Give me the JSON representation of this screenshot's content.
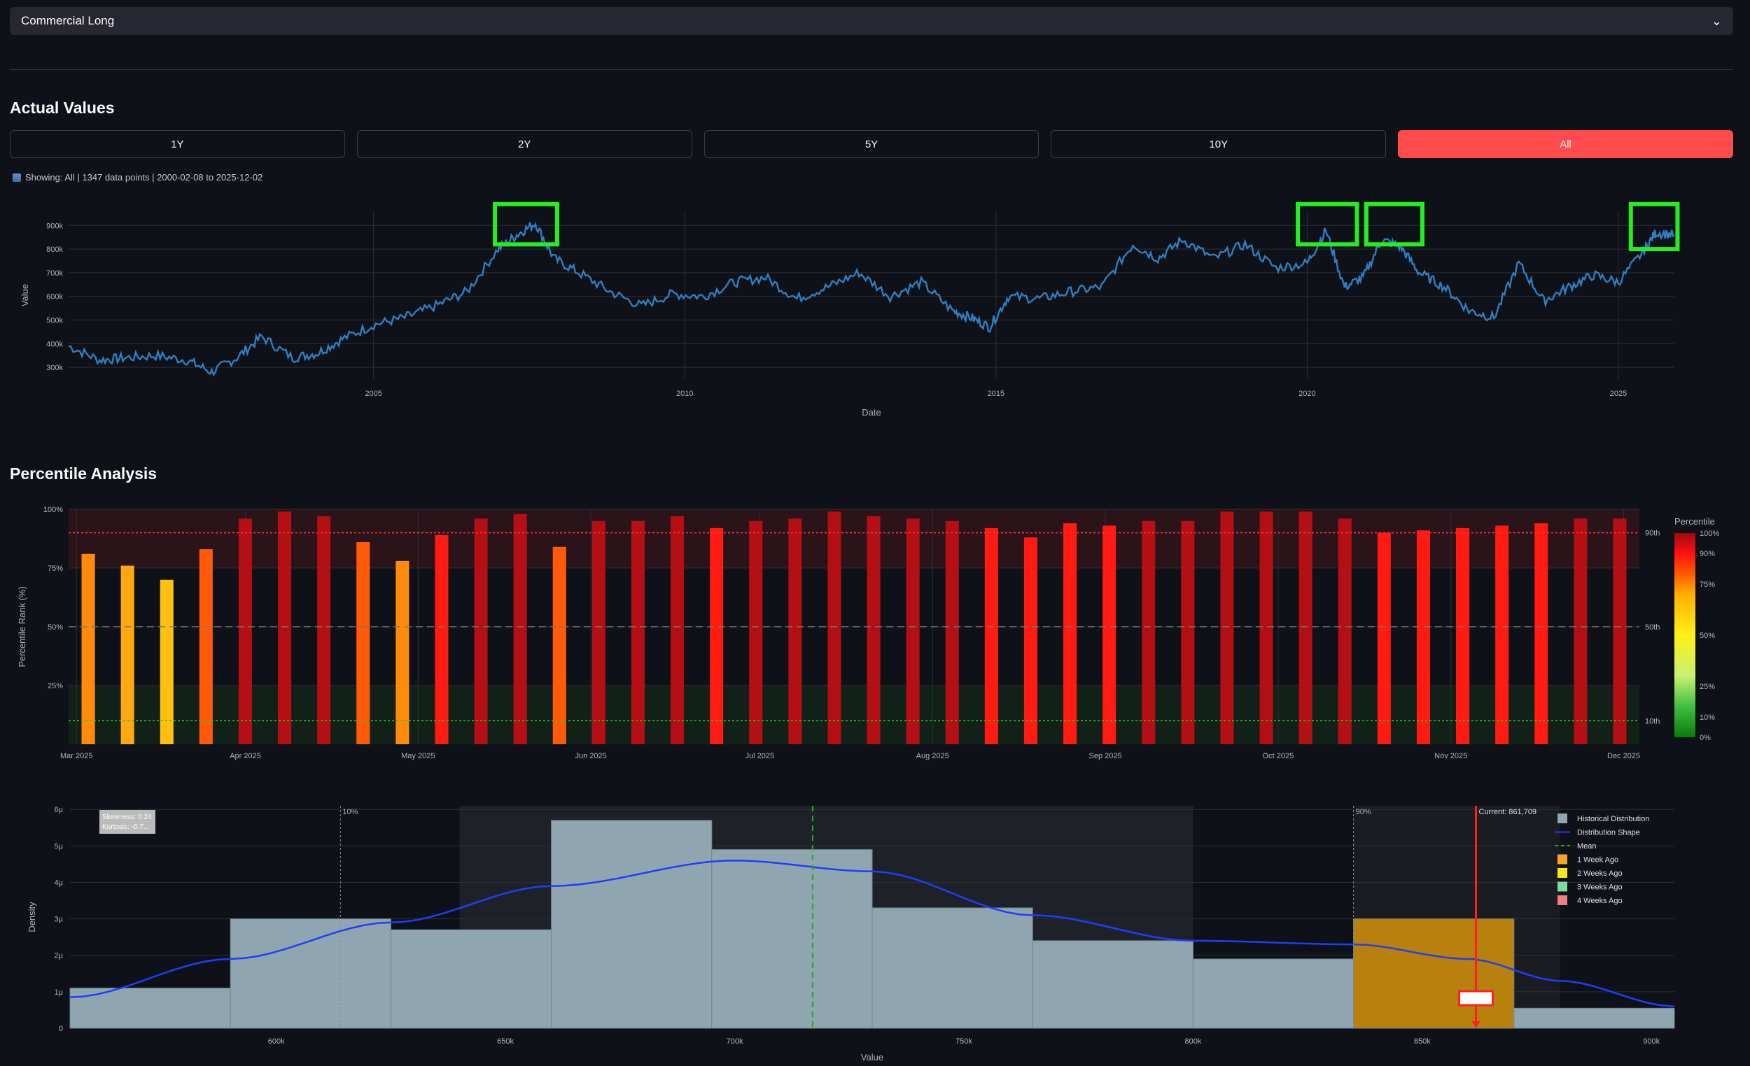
{
  "selector": {
    "value": "Commercial Long"
  },
  "sections": {
    "actual_title": "Actual Values",
    "percentile_title": "Percentile Analysis"
  },
  "ranges": [
    {
      "label": "1Y",
      "active": false
    },
    {
      "label": "2Y",
      "active": false
    },
    {
      "label": "5Y",
      "active": false
    },
    {
      "label": "10Y",
      "active": false
    },
    {
      "label": "All",
      "active": true
    }
  ],
  "caption": "Showing: All | 1347 data points | 2000-02-08 to 2025-12-02",
  "colors": {
    "accent": "#ff4b4b",
    "line": "#2f7fc1",
    "highlight": "#22ee22",
    "hist": "#8fa5b0",
    "current_bin": "#b8800d"
  },
  "chart_data": [
    {
      "type": "line",
      "xlabel": "Date",
      "ylabel": "Value",
      "xlim": [
        2000.1,
        2025.9
      ],
      "ylim": [
        250000,
        960000
      ],
      "x_ticks": [
        {
          "v": 2005,
          "label": "2005"
        },
        {
          "v": 2010,
          "label": "2010"
        },
        {
          "v": 2015,
          "label": "2015"
        },
        {
          "v": 2020,
          "label": "2020"
        },
        {
          "v": 2025,
          "label": "2025"
        }
      ],
      "y_ticks": [
        {
          "v": 300000,
          "label": "300k"
        },
        {
          "v": 400000,
          "label": "400k"
        },
        {
          "v": 500000,
          "label": "500k"
        },
        {
          "v": 600000,
          "label": "600k"
        },
        {
          "v": 700000,
          "label": "700k"
        },
        {
          "v": 800000,
          "label": "800k"
        },
        {
          "v": 900000,
          "label": "900k"
        }
      ],
      "x": [
        2000.1,
        2000.6,
        2001.0,
        2001.5,
        2002.0,
        2002.4,
        2002.8,
        2003.2,
        2003.7,
        2004.1,
        2004.5,
        2005.0,
        2005.5,
        2006.0,
        2006.5,
        2007.0,
        2007.3,
        2007.6,
        2007.9,
        2008.3,
        2008.8,
        2009.3,
        2009.8,
        2010.3,
        2010.8,
        2011.3,
        2011.8,
        2012.3,
        2012.8,
        2013.3,
        2013.8,
        2014.3,
        2014.6,
        2014.9,
        2015.2,
        2015.7,
        2016.2,
        2016.7,
        2017.2,
        2017.6,
        2018.0,
        2018.5,
        2019.0,
        2019.5,
        2020.0,
        2020.3,
        2020.6,
        2020.9,
        2021.2,
        2021.5,
        2021.8,
        2022.2,
        2022.6,
        2023.0,
        2023.4,
        2023.8,
        2024.2,
        2024.6,
        2025.0,
        2025.4,
        2025.6,
        2025.9
      ],
      "y": [
        390000,
        330000,
        340000,
        350000,
        330000,
        280000,
        340000,
        430000,
        340000,
        360000,
        420000,
        480000,
        510000,
        560000,
        620000,
        800000,
        860000,
        910000,
        760000,
        700000,
        620000,
        560000,
        610000,
        600000,
        660000,
        680000,
        590000,
        640000,
        700000,
        600000,
        660000,
        540000,
        510000,
        470000,
        600000,
        590000,
        620000,
        640000,
        820000,
        760000,
        840000,
        760000,
        820000,
        720000,
        740000,
        880000,
        640000,
        680000,
        840000,
        810000,
        700000,
        640000,
        540000,
        510000,
        740000,
        580000,
        640000,
        690000,
        660000,
        790000,
        870000,
        860000
      ],
      "highlights": [
        {
          "x0": 2006.95,
          "x1": 2007.95,
          "y0": 820000,
          "y1": 1000000
        },
        {
          "x0": 2019.85,
          "x1": 2020.8,
          "y0": 820000,
          "y1": 1000000
        },
        {
          "x0": 2020.95,
          "x1": 2021.85,
          "y0": 820000,
          "y1": 1000000
        },
        {
          "x0": 2025.2,
          "x1": 2025.95,
          "y0": 800000,
          "y1": 1000000
        }
      ]
    },
    {
      "type": "bar",
      "ylabel": "Percentile Rank (%)",
      "ylim": [
        0,
        100
      ],
      "y_ticks": [
        {
          "v": 25,
          "label": "25%"
        },
        {
          "v": 50,
          "label": "50%"
        },
        {
          "v": 75,
          "label": "75%"
        },
        {
          "v": 100,
          "label": "100%"
        }
      ],
      "x_ticks": [
        {
          "i": 0,
          "label": "Mar 2025"
        },
        {
          "i": 4.3,
          "label": "Apr 2025"
        },
        {
          "i": 8.7,
          "label": "May 2025"
        },
        {
          "i": 13.1,
          "label": "Jun 2025"
        },
        {
          "i": 17.4,
          "label": "Jul 2025"
        },
        {
          "i": 21.8,
          "label": "Aug 2025"
        },
        {
          "i": 26.2,
          "label": "Sep 2025"
        },
        {
          "i": 30.6,
          "label": "Oct 2025"
        },
        {
          "i": 35,
          "label": "Nov 2025"
        },
        {
          "i": 39.4,
          "label": "Dec 2025"
        }
      ],
      "values": [
        81,
        76,
        70,
        83,
        96,
        99,
        97,
        86,
        78,
        89,
        96,
        98,
        84,
        95,
        95,
        97,
        92,
        95,
        96,
        99,
        97,
        96,
        95,
        92,
        88,
        94,
        93,
        95,
        95,
        99,
        99,
        99,
        96,
        90,
        91,
        92,
        93,
        94,
        96,
        96
      ],
      "reference_lines": [
        {
          "v": 90,
          "label": "90th",
          "color": "#ff3030"
        },
        {
          "v": 50,
          "label": "50th",
          "color": "#777777"
        },
        {
          "v": 10,
          "label": "10th",
          "color": "#22cc22"
        }
      ],
      "colorbar": {
        "title": "Percentile",
        "ticks": [
          "100%",
          "90%",
          "75%",
          "50%",
          "25%",
          "10%",
          "0%"
        ]
      }
    },
    {
      "type": "histogram",
      "xlabel": "Value",
      "ylabel": "Density",
      "xlim": [
        555000,
        905000
      ],
      "ylim": [
        0,
        6.1e-06
      ],
      "x_ticks": [
        {
          "v": 600000,
          "label": "600k"
        },
        {
          "v": 650000,
          "label": "650k"
        },
        {
          "v": 700000,
          "label": "700k"
        },
        {
          "v": 750000,
          "label": "750k"
        },
        {
          "v": 800000,
          "label": "800k"
        },
        {
          "v": 850000,
          "label": "850k"
        },
        {
          "v": 900000,
          "label": "900k"
        }
      ],
      "y_ticks": [
        {
          "v": 0,
          "label": "0"
        },
        {
          "v": 1e-06,
          "label": "1μ"
        },
        {
          "v": 2e-06,
          "label": "2μ"
        },
        {
          "v": 3e-06,
          "label": "3μ"
        },
        {
          "v": 4e-06,
          "label": "4μ"
        },
        {
          "v": 5e-06,
          "label": "5μ"
        },
        {
          "v": 6e-06,
          "label": "6μ"
        }
      ],
      "bins": [
        {
          "x0": 555000,
          "x1": 590000,
          "v": 1.1e-06
        },
        {
          "x0": 590000,
          "x1": 625000,
          "v": 3e-06
        },
        {
          "x0": 625000,
          "x1": 660000,
          "v": 2.7e-06
        },
        {
          "x0": 660000,
          "x1": 695000,
          "v": 5.7e-06
        },
        {
          "x0": 695000,
          "x1": 730000,
          "v": 4.9e-06
        },
        {
          "x0": 730000,
          "x1": 765000,
          "v": 3.3e-06
        },
        {
          "x0": 765000,
          "x1": 800000,
          "v": 2.4e-06
        },
        {
          "x0": 800000,
          "x1": 835000,
          "v": 1.9e-06
        },
        {
          "x0": 835000,
          "x1": 870000,
          "v": 3e-06,
          "current": true
        },
        {
          "x0": 870000,
          "x1": 905000,
          "v": 5.5e-07
        }
      ],
      "kde_x": [
        555000,
        590000,
        625000,
        660000,
        700000,
        730000,
        765000,
        800000,
        835000,
        860000,
        880000,
        905000
      ],
      "kde_y": [
        8.5e-07,
        1.9e-06,
        2.9e-06,
        3.9e-06,
        4.6e-06,
        4.3e-06,
        3.1e-06,
        2.4e-06,
        2.3e-06,
        1.9e-06,
        1.3e-06,
        6e-07
      ],
      "mean": 717000,
      "p10": 614000,
      "p90": 835000,
      "current": 861709,
      "current_label": "Current: 861,709",
      "p10_label": "10%",
      "p90_label": "90%",
      "stats_box": [
        "Skewness: 0.24",
        "Kurtosis: -0.7..."
      ],
      "legend": [
        {
          "label": "Historical Distribution",
          "kind": "box",
          "color": "#8fa5b0"
        },
        {
          "label": "Distribution Shape",
          "kind": "line",
          "color": "#1e3dff"
        },
        {
          "label": "Mean",
          "kind": "dash",
          "color": "#22aa22"
        },
        {
          "label": "1 Week Ago",
          "kind": "box",
          "color": "#f5a623"
        },
        {
          "label": "2 Weeks Ago",
          "kind": "box",
          "color": "#f5e61d"
        },
        {
          "label": "3 Weeks Ago",
          "kind": "box",
          "color": "#7ed99b"
        },
        {
          "label": "4 Weeks Ago",
          "kind": "box",
          "color": "#f08080"
        }
      ]
    }
  ]
}
